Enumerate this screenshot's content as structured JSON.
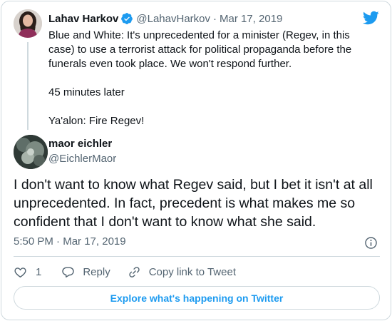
{
  "parent_tweet": {
    "name": "Lahav Harkov",
    "handle": "@LahavHarkov",
    "separator": "·",
    "date": "Mar 17, 2019",
    "lines": [
      "Blue and White: It's unprecedented for a minister (Regev, in this case) to use a terrorist attack for political propaganda before the funerals even took place. We won't respond further.",
      "45 minutes later",
      "Ya'alon: Fire Regev!"
    ]
  },
  "main_tweet": {
    "name": "maor eichler",
    "handle": "@EichlerMaor",
    "text": "I don't want to know what Regev said, but I bet it isn't at all unprecedented. In fact, precedent is what makes me so confident that I don't want to know what she said.",
    "time": "5:50 PM",
    "separator": "·",
    "date": "Mar 17, 2019"
  },
  "actions": {
    "like_count": "1",
    "reply_label": "Reply",
    "copy_label": "Copy link to Tweet"
  },
  "explore_label": "Explore what's happening on Twitter",
  "icons": {
    "brand": "twitter-bird-icon",
    "verified": "verified-badge-icon",
    "info": "info-icon",
    "like": "heart-icon",
    "reply": "speech-bubble-icon",
    "copy": "link-icon"
  },
  "colors": {
    "accent": "#1d9bf0",
    "text": "#0f1419",
    "secondary": "#536471",
    "border": "#cfd9de"
  }
}
